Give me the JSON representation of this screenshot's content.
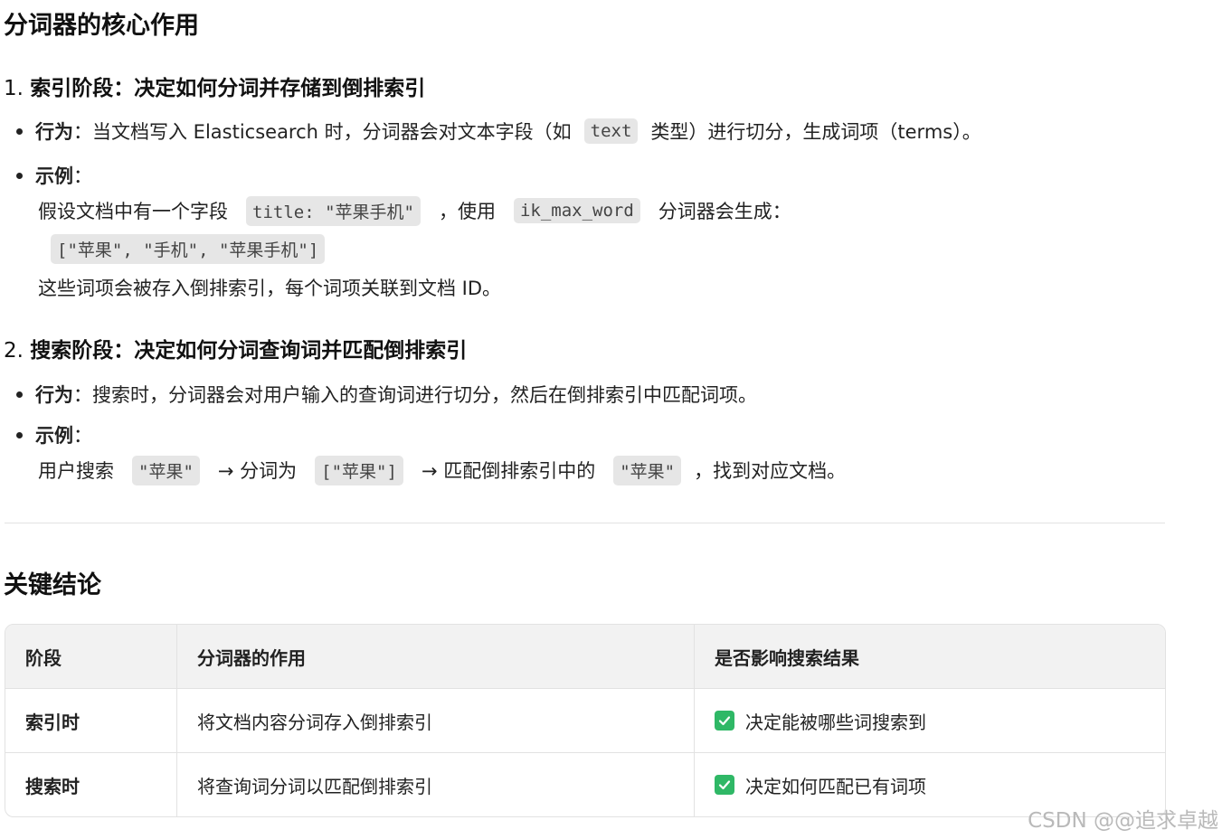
{
  "title": "分词器的核心作用",
  "sec1": {
    "heading_num": "1.",
    "heading": "索引阶段：决定如何分词并存储到倒排索引",
    "b1_label": "行为",
    "b1_colon": "：",
    "b1_pre": "当文档写入 Elasticsearch 时，分词器会对文本字段（如",
    "b1_code": "text",
    "b1_post": "类型）进行切分，生成词项（terms）。",
    "b2_label": "示例",
    "b2_colon": "：",
    "ex_pre": "假设文档中有一个字段",
    "ex_code1": "title: \"苹果手机\"",
    "ex_mid": "，使用",
    "ex_code2": "ik_max_word",
    "ex_post": "分词器会生成：",
    "ex_code3": "[\"苹果\", \"手机\", \"苹果手机\"]",
    "ex_tail": "这些词项会被存入倒排索引，每个词项关联到文档 ID。"
  },
  "sec2": {
    "heading_num": "2.",
    "heading": "搜索阶段：决定如何分词查询词并匹配倒排索引",
    "b1_label": "行为",
    "b1_colon": "：",
    "b1_text": "搜索时，分词器会对用户输入的查询词进行切分，然后在倒排索引中匹配词项。",
    "b2_label": "示例",
    "b2_colon": "：",
    "ex_pre": "用户搜索",
    "ex_code1": "\"苹果\"",
    "ex_mid1": "→ 分词为",
    "ex_code2": "[\"苹果\"]",
    "ex_mid2": "→ 匹配倒排索引中的",
    "ex_code3": "\"苹果\"",
    "ex_post": "，找到对应文档。"
  },
  "conclusion": {
    "title": "关键结论",
    "headers": [
      "阶段",
      "分词器的作用",
      "是否影响搜索结果"
    ],
    "rows": [
      [
        "索引时",
        "将文档内容分词存入倒排索引",
        "决定能被哪些词搜索到"
      ],
      [
        "搜索时",
        "将查询词分词以匹配倒排索引",
        "决定如何匹配已有词项"
      ]
    ],
    "check_icon": "check-box-icon",
    "check_color": "#2fb866"
  },
  "watermark": "CSDN @@追求卓越"
}
